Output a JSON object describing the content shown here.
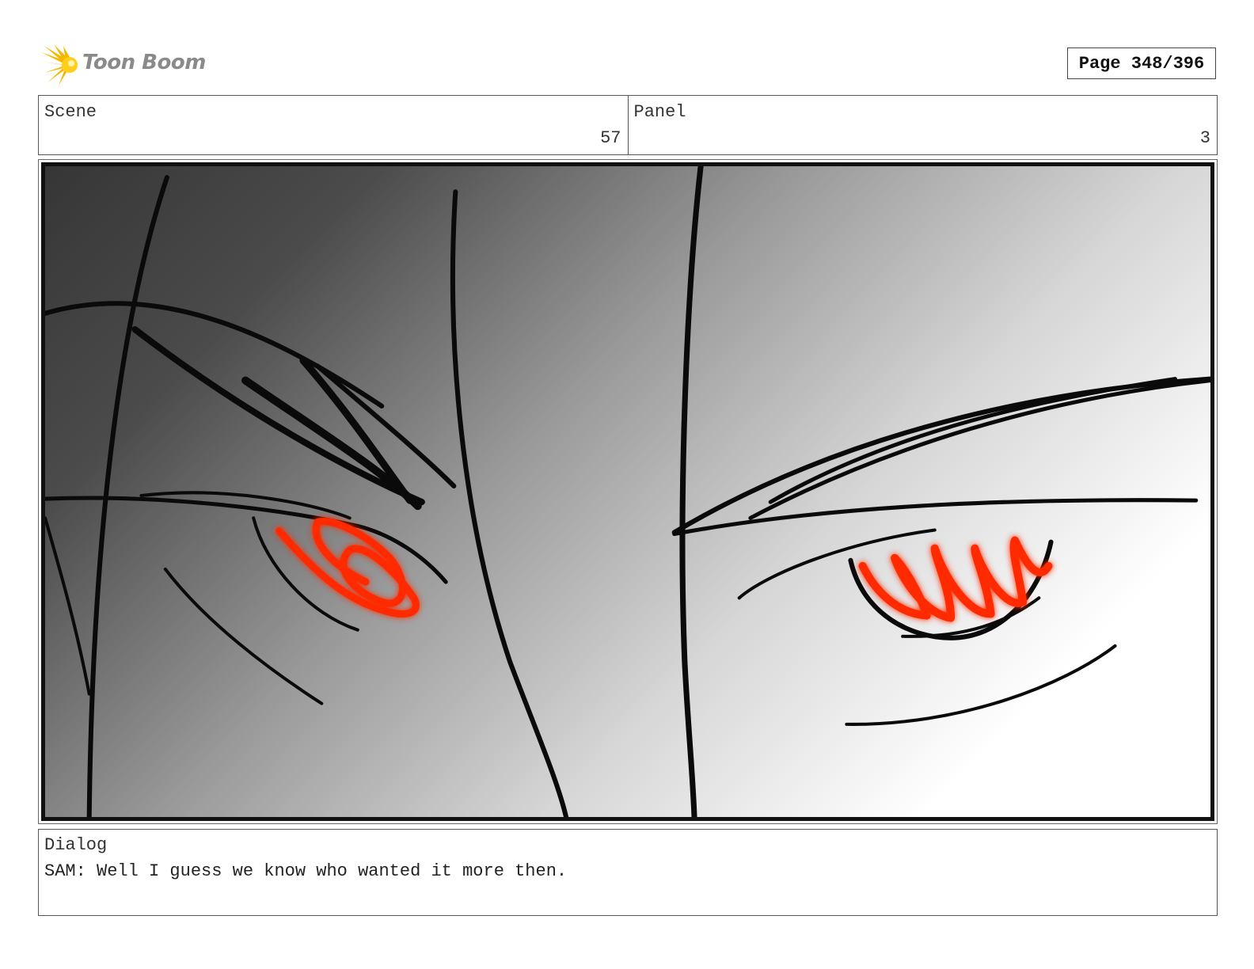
{
  "header": {
    "brand": "Toon Boom",
    "page_label": "Page 348/396"
  },
  "scene": {
    "label": "Scene",
    "value": "57"
  },
  "panel": {
    "label": "Panel",
    "value": "3"
  },
  "dialog": {
    "label": "Dialog",
    "text": "SAM: Well I guess we know who wanted it more then."
  },
  "colors": {
    "gradient_dark": "#3a3a3a",
    "gradient_light": "#ffffff",
    "eye_glow": "#ff2a00",
    "ink": "#0a0a0a"
  },
  "icons": {
    "logo": "toon-boom-starburst-icon"
  }
}
